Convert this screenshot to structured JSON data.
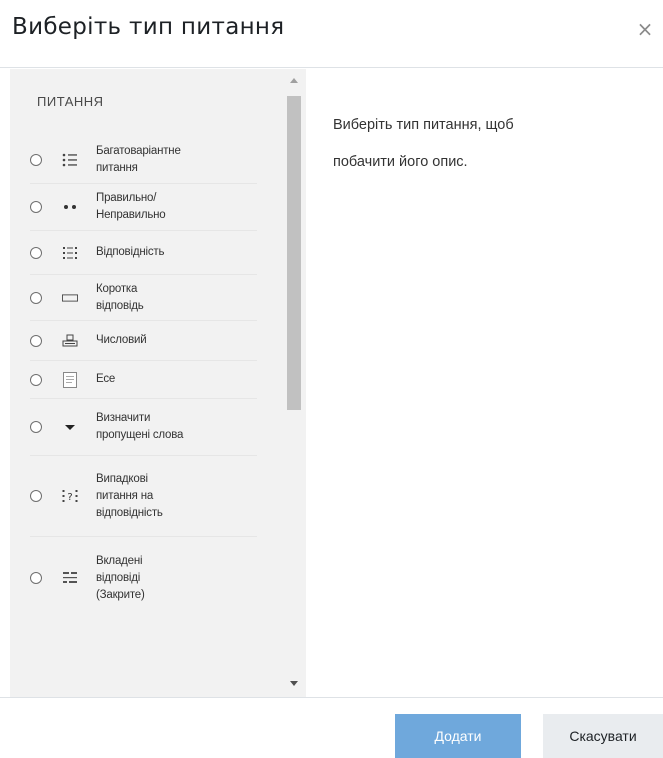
{
  "modal": {
    "title": "Виберіть тип питання",
    "close_symbol": "×"
  },
  "left": {
    "section_label": "ПИТАННЯ",
    "items": [
      {
        "label_lines": [
          "Багатоваріантне",
          "питання"
        ],
        "icon": "multichoice-icon"
      },
      {
        "label_lines": [
          "Правильно/",
          "Неправильно"
        ],
        "icon": "truefalse-icon"
      },
      {
        "label_lines": [
          "Відповідність"
        ],
        "icon": "matching-icon"
      },
      {
        "label_lines": [
          "Коротка",
          "відповідь"
        ],
        "icon": "shortanswer-icon"
      },
      {
        "label_lines": [
          "Числовий"
        ],
        "icon": "numerical-icon"
      },
      {
        "label_lines": [
          "Есе"
        ],
        "icon": "essay-icon"
      },
      {
        "label_lines": [
          "Визначити",
          "пропущені слова"
        ],
        "icon": "select-missing-words-icon"
      },
      {
        "label_lines": [
          "Випадкові",
          "питання на",
          "відповідність"
        ],
        "icon": "random-matching-icon"
      },
      {
        "label_lines": [
          "Вкладені",
          "відповіді",
          "(Закрите)"
        ],
        "icon": "embedded-answers-icon"
      }
    ]
  },
  "right": {
    "description_line1": "Виберіть тип питання, щоб",
    "description_line2": "побачити його опис."
  },
  "footer": {
    "add_label": "Додати",
    "cancel_label": "Скасувати"
  },
  "colors": {
    "primary": "#6fa8dc",
    "left_pane_bg": "#f2f2f2",
    "cancel_bg": "#e9ecef"
  }
}
